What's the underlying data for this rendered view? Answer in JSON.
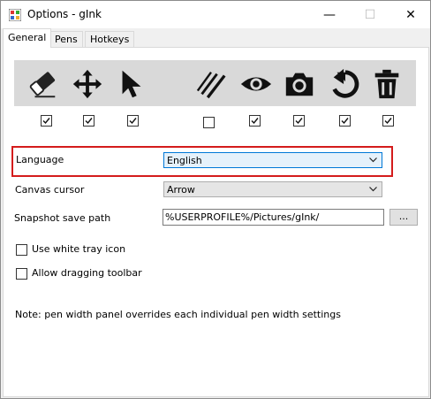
{
  "window": {
    "title": "Options - gInk",
    "minimize_glyph": "—",
    "maximize_glyph": "☐",
    "close_glyph": "✕"
  },
  "tabs": [
    {
      "label": "General",
      "active": true
    },
    {
      "label": "Pens",
      "active": false
    },
    {
      "label": "Hotkeys",
      "active": false
    }
  ],
  "toolbar": {
    "tools": [
      {
        "icon": "eraser-icon",
        "enabled": true
      },
      {
        "icon": "move-icon",
        "enabled": true
      },
      {
        "icon": "pointer-icon",
        "enabled": true
      },
      {
        "icon": "pen-width-icon",
        "enabled": false
      },
      {
        "icon": "eye-icon",
        "enabled": true
      },
      {
        "icon": "camera-icon",
        "enabled": true
      },
      {
        "icon": "undo-icon",
        "enabled": true
      },
      {
        "icon": "trash-icon",
        "enabled": true
      }
    ]
  },
  "settings": {
    "language_label": "Language",
    "language_value": "English",
    "cursor_label": "Canvas cursor",
    "cursor_value": "Arrow",
    "snapshot_label": "Snapshot save path",
    "snapshot_value": "%USERPROFILE%/Pictures/gInk/",
    "browse_label": "...",
    "white_tray_label": "Use white tray icon",
    "white_tray_checked": false,
    "allow_drag_label": "Allow dragging toolbar",
    "allow_drag_checked": false,
    "note": "Note: pen width panel overrides each individual pen width settings"
  },
  "colors": {
    "highlight_border": "#d41c1c",
    "focus_border": "#0078d7",
    "toolbar_bg": "#d9d9d9"
  }
}
